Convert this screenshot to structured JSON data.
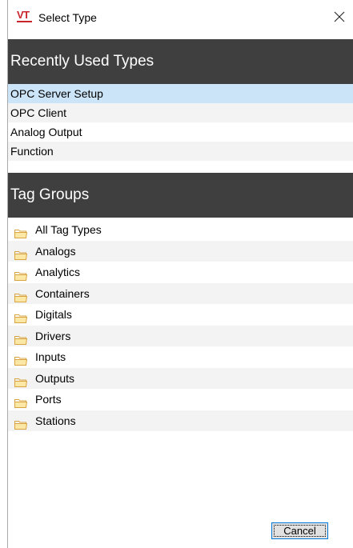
{
  "window": {
    "title": "Select Type",
    "close_glyph": "✕"
  },
  "recent": {
    "header": "Recently Used Types",
    "items": [
      "OPC Server Setup",
      "OPC Client",
      "Analog Output",
      "Function"
    ],
    "selected_index": 0
  },
  "groups": {
    "header": "Tag Groups",
    "items": [
      "All Tag Types",
      "Analogs",
      "Analytics",
      "Containers",
      "Digitals",
      "Drivers",
      "Inputs",
      "Outputs",
      "Ports",
      "Stations"
    ],
    "icon": "folder-icon"
  },
  "footer": {
    "cancel_label": "Cancel"
  },
  "colors": {
    "header_bg": "#3f3f3f",
    "selected_bg": "#cce4f7",
    "alt_row_bg": "#f3f3f3",
    "folder": "#d9a440",
    "brand": "#c8262b"
  }
}
